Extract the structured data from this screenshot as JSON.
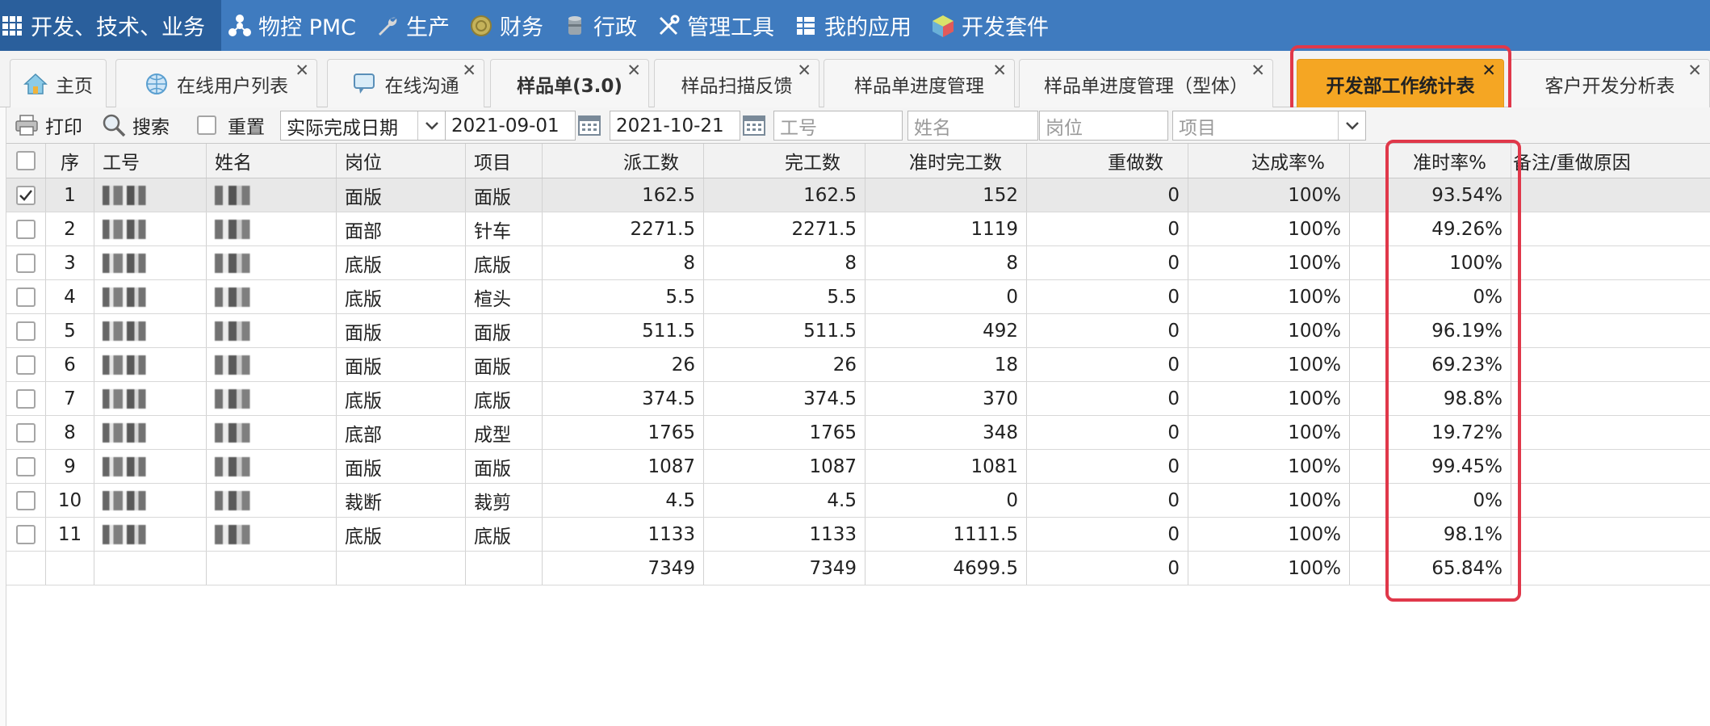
{
  "topnav": {
    "items": [
      {
        "label": "开发、技术、业务",
        "icon": "grid-icon"
      },
      {
        "label": "物控 PMC",
        "icon": "network-icon"
      },
      {
        "label": "生产",
        "icon": "wrench-icon"
      },
      {
        "label": "财务",
        "icon": "coin-icon"
      },
      {
        "label": "行政",
        "icon": "cylinder-icon"
      },
      {
        "label": "管理工具",
        "icon": "tools-icon"
      },
      {
        "label": "我的应用",
        "icon": "table-icon"
      },
      {
        "label": "开发套件",
        "icon": "cube-icon"
      }
    ]
  },
  "tabs": [
    {
      "label": "主页",
      "icon": "home-icon",
      "closable": false
    },
    {
      "label": "在线用户列表",
      "icon": "globe-icon",
      "closable": true
    },
    {
      "label": "在线沟通",
      "icon": "chat-icon",
      "closable": true
    },
    {
      "label": "样品单(3.0)",
      "closable": true
    },
    {
      "label": "样品扫描反馈",
      "closable": true
    },
    {
      "label": "样品单进度管理",
      "closable": true
    },
    {
      "label": "样品单进度管理（型体）",
      "closable": true
    },
    {
      "label": "开发部工作统计表",
      "closable": true,
      "active": true
    },
    {
      "label": "客户开发分析表",
      "closable": true
    }
  ],
  "toolbar": {
    "print_label": "打印",
    "search_label": "搜索",
    "reset_label": "重置",
    "date_type": "实际完成日期",
    "date_from": "2021-09-01",
    "date_to": "2021-10-21",
    "emp_no_placeholder": "工号",
    "name_placeholder": "姓名",
    "position_placeholder": "岗位",
    "project_placeholder": "项目"
  },
  "grid": {
    "columns": [
      "序",
      "工号",
      "姓名",
      "岗位",
      "项目",
      "派工数",
      "完工数",
      "准时完工数",
      "重做数",
      "达成率%",
      "准时率%",
      "备注/重做原因"
    ],
    "rows": [
      {
        "no": "1",
        "position": "面版",
        "project": "面版",
        "dispatched": "162.5",
        "completed": "162.5",
        "ontime": "152",
        "redo": "0",
        "achieve": "100%",
        "ontime_rate": "93.54%",
        "remark": "",
        "checked": true
      },
      {
        "no": "2",
        "position": "面部",
        "project": "针车",
        "dispatched": "2271.5",
        "completed": "2271.5",
        "ontime": "1119",
        "redo": "0",
        "achieve": "100%",
        "ontime_rate": "49.26%",
        "remark": "",
        "checked": false
      },
      {
        "no": "3",
        "position": "底版",
        "project": "底版",
        "dispatched": "8",
        "completed": "8",
        "ontime": "8",
        "redo": "0",
        "achieve": "100%",
        "ontime_rate": "100%",
        "remark": "",
        "checked": false
      },
      {
        "no": "4",
        "position": "底版",
        "project": "楦头",
        "dispatched": "5.5",
        "completed": "5.5",
        "ontime": "0",
        "redo": "0",
        "achieve": "100%",
        "ontime_rate": "0%",
        "remark": "",
        "checked": false
      },
      {
        "no": "5",
        "position": "面版",
        "project": "面版",
        "dispatched": "511.5",
        "completed": "511.5",
        "ontime": "492",
        "redo": "0",
        "achieve": "100%",
        "ontime_rate": "96.19%",
        "remark": "",
        "checked": false
      },
      {
        "no": "6",
        "position": "面版",
        "project": "面版",
        "dispatched": "26",
        "completed": "26",
        "ontime": "18",
        "redo": "0",
        "achieve": "100%",
        "ontime_rate": "69.23%",
        "remark": "",
        "checked": false
      },
      {
        "no": "7",
        "position": "底版",
        "project": "底版",
        "dispatched": "374.5",
        "completed": "374.5",
        "ontime": "370",
        "redo": "0",
        "achieve": "100%",
        "ontime_rate": "98.8%",
        "remark": "",
        "checked": false
      },
      {
        "no": "8",
        "position": "底部",
        "project": "成型",
        "dispatched": "1765",
        "completed": "1765",
        "ontime": "348",
        "redo": "0",
        "achieve": "100%",
        "ontime_rate": "19.72%",
        "remark": "",
        "checked": false
      },
      {
        "no": "9",
        "position": "面版",
        "project": "面版",
        "dispatched": "1087",
        "completed": "1087",
        "ontime": "1081",
        "redo": "0",
        "achieve": "100%",
        "ontime_rate": "99.45%",
        "remark": "",
        "checked": false
      },
      {
        "no": "10",
        "position": "裁断",
        "project": "裁剪",
        "dispatched": "4.5",
        "completed": "4.5",
        "ontime": "0",
        "redo": "0",
        "achieve": "100%",
        "ontime_rate": "0%",
        "remark": "",
        "checked": false
      },
      {
        "no": "11",
        "position": "底版",
        "project": "底版",
        "dispatched": "1133",
        "completed": "1133",
        "ontime": "1111.5",
        "redo": "0",
        "achieve": "100%",
        "ontime_rate": "98.1%",
        "remark": "",
        "checked": false
      }
    ],
    "totals": {
      "dispatched": "7349",
      "completed": "7349",
      "ontime": "4699.5",
      "redo": "0",
      "achieve": "100%",
      "ontime_rate": "65.84%"
    }
  },
  "colors": {
    "nav_bg": "#3f7bbf",
    "active_tab": "#f5a623",
    "highlight": "#e0384a"
  }
}
